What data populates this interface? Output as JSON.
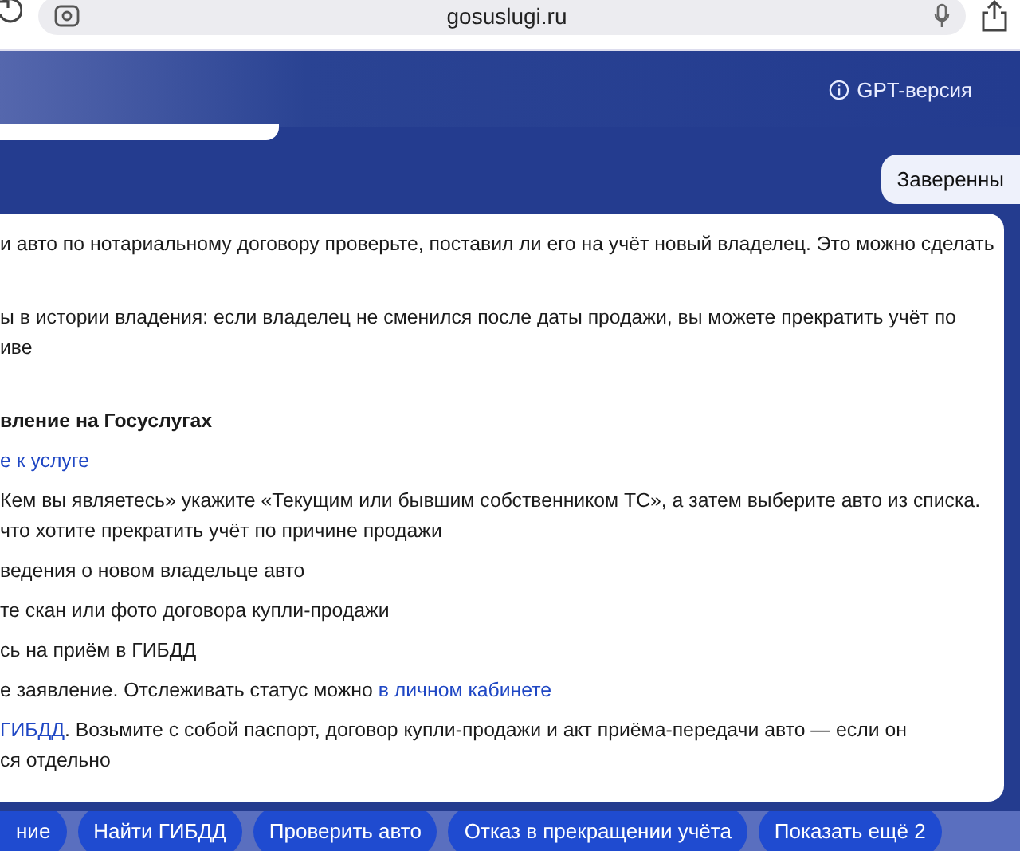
{
  "browser": {
    "url": "gosuslugi.ru"
  },
  "header": {
    "gpt_label": "GPT-версия"
  },
  "user_message": "Заверенны",
  "answer": [
    {
      "kind": "lead",
      "parts": [
        {
          "text": "и авто по нотариальному договору проверьте, поставил ли его на учёт новый владелец. Это можно сделать",
          "link": false
        }
      ]
    },
    {
      "kind": "lead",
      "lines": [
        [
          {
            "text": "ы в истории владения: если владелец не сменился после даты продажи, вы можете прекратить учёт по",
            "link": false
          }
        ],
        [
          {
            "text": "иве",
            "link": false
          }
        ]
      ]
    },
    {
      "kind": "heading",
      "parts": [
        {
          "text": "вление на Госуслугах",
          "link": false
        }
      ]
    },
    {
      "kind": "paragraph",
      "parts": [
        {
          "text": "е к услуге",
          "link": true
        }
      ]
    },
    {
      "kind": "paragraph",
      "lines": [
        [
          {
            "text": "Кем вы являетесь» укажите «Текущим или бывшим собственником ТС», а затем выберите авто из списка.",
            "link": false
          }
        ],
        [
          {
            "text": "что хотите прекратить учёт по причине продажи",
            "link": false
          }
        ]
      ]
    },
    {
      "kind": "paragraph",
      "parts": [
        {
          "text": "ведения о новом владельце авто",
          "link": false
        }
      ]
    },
    {
      "kind": "paragraph",
      "parts": [
        {
          "text": "те скан или фото договора купли-продажи",
          "link": false
        }
      ]
    },
    {
      "kind": "paragraph",
      "parts": [
        {
          "text": "сь на приём в ГИБДД",
          "link": false
        }
      ]
    },
    {
      "kind": "paragraph",
      "parts": [
        {
          "text": "е заявление. Отслеживать статус можно ",
          "link": false
        },
        {
          "text": "в личном кабинете",
          "link": true
        }
      ]
    },
    {
      "kind": "paragraph",
      "lines": [
        [
          {
            "text": "ГИБДД",
            "link": true
          },
          {
            "text": ". Возьмите с собой паспорт, договор купли-продажи и акт приёма-передачи авто — если он",
            "link": false
          }
        ],
        [
          {
            "text": "ся отдельно",
            "link": false
          }
        ]
      ]
    }
  ],
  "chips": [
    "ние",
    "Найти ГИБДД",
    "Проверить авто",
    "Отказ в прекращении учёта",
    "Показать ещё 2"
  ]
}
